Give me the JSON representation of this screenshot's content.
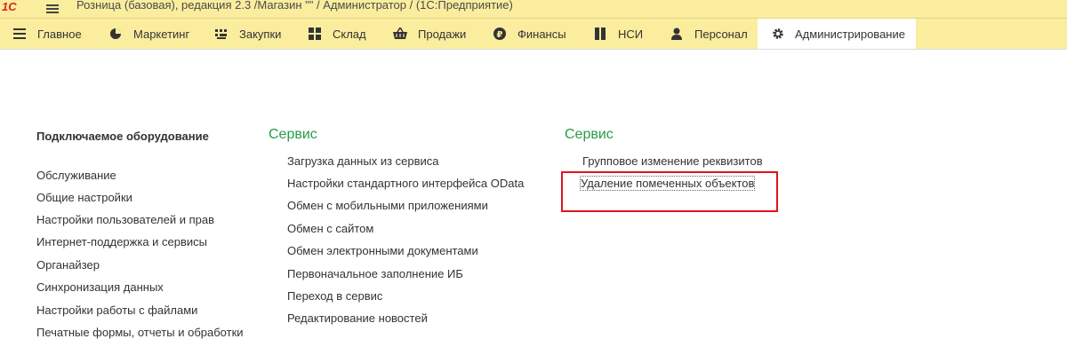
{
  "titlebar": {
    "logo": "1С",
    "title": "Розница (базовая), редакция 2.3 /Магазин \"\" / Администратор /  (1С:Предприятие)"
  },
  "sections": [
    {
      "label": "Главное",
      "icon": "menu-icon"
    },
    {
      "label": "Маркетинг",
      "icon": "pie-chart-icon"
    },
    {
      "label": "Закупки",
      "icon": "purchases-icon"
    },
    {
      "label": "Склад",
      "icon": "warehouse-grid-icon"
    },
    {
      "label": "Продажи",
      "icon": "basket-icon"
    },
    {
      "label": "Финансы",
      "icon": "ruble-coin-icon"
    },
    {
      "label": "НСИ",
      "icon": "book-icon"
    },
    {
      "label": "Персонал",
      "icon": "person-icon"
    },
    {
      "label": "Администрирование",
      "icon": "gear-icon",
      "active": true
    }
  ],
  "col1": {
    "heading": "Подключаемое оборудование",
    "items": [
      "Обслуживание",
      "Общие настройки",
      "Настройки пользователей и прав",
      "Интернет-поддержка и сервисы",
      "Органайзер",
      "Синхронизация данных",
      "Настройки работы с файлами",
      "Печатные формы, отчеты и обработки"
    ]
  },
  "col2": {
    "heading": "Сервис",
    "items": [
      "Загрузка данных из сервиса",
      "Настройки стандартного интерфейса OData",
      "Обмен с мобильными приложениями",
      "Обмен с сайтом",
      "Обмен электронными документами",
      "Первоначальное заполнение ИБ",
      "Переход в сервис",
      "Редактирование новостей"
    ]
  },
  "col3": {
    "heading": "Сервис",
    "items": [
      "Групповое изменение реквизитов",
      "Удаление помеченных объектов"
    ]
  },
  "colors": {
    "panel": "#fbed9e",
    "green_heading": "#2a9a48",
    "highlight": "#e0141e"
  }
}
